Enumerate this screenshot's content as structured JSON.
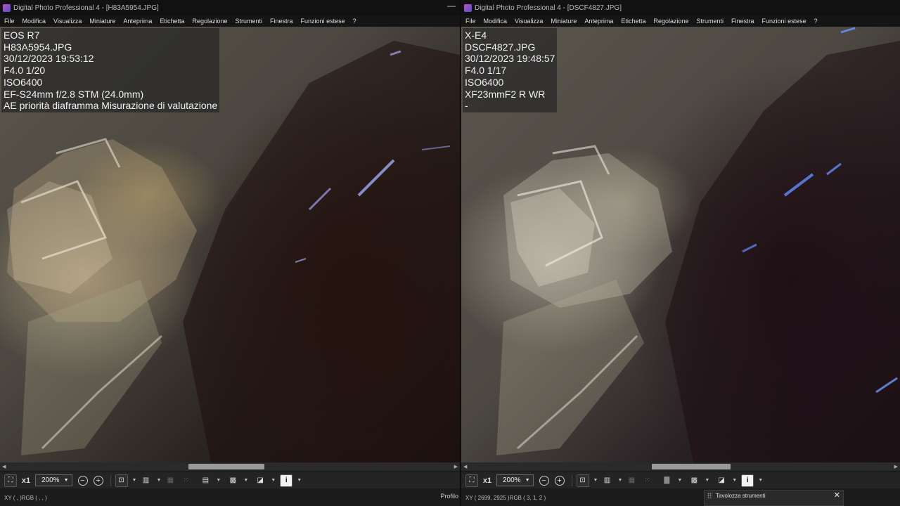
{
  "left": {
    "title": "Digital Photo Professional 4 - [H83A5954.JPG]",
    "menu": [
      "File",
      "Modifica",
      "Visualizza",
      "Miniature",
      "Anteprima",
      "Etichetta",
      "Regolazione",
      "Strumenti",
      "Finestra",
      "Funzioni estese",
      "?"
    ],
    "exif": [
      "EOS R7",
      "H83A5954.JPG",
      "30/12/2023 19:53:12",
      "F4.0 1/20",
      "ISO6400",
      "EF-S24mm f/2.8 STM (24.0mm)",
      "AE priorità diaframma Misurazione di valutazione"
    ],
    "zoom_factor": "x1",
    "zoom_value": "200%",
    "status": "XY (    ,    )RGB (   ,   ,   )",
    "profilo": "Profilo",
    "scroll_position": 0.49
  },
  "right": {
    "title": "Digital Photo Professional 4 - [DSCF4827.JPG]",
    "menu": [
      "File",
      "Modifica",
      "Visualizza",
      "Miniature",
      "Anteprima",
      "Etichetta",
      "Regolazione",
      "Strumenti",
      "Finestra",
      "Funzioni estese",
      "?"
    ],
    "exif": [
      "X-E4",
      "DSCF4827.JPG",
      "30/12/2023 19:48:57",
      "F4.0 1/17",
      "ISO6400",
      "XF23mmF2 R WR",
      "-"
    ],
    "zoom_factor": "x1",
    "zoom_value": "200%",
    "status": "XY ( 2699, 2925 )RGB (  3,   1,   2 )",
    "scroll_position": 0.53
  },
  "palette": {
    "title": "Tavolozza strumenti",
    "close": "✕"
  },
  "icons": {
    "fit": "fit-window-icon",
    "zoom_out": "zoom-out-icon",
    "zoom_in": "zoom-in-icon",
    "af_point": "af-point-icon",
    "layout": "layout-icon",
    "grid": "grid-icon",
    "highlight": "highlight-warning-icon",
    "color": "color-adjust-icon",
    "info": "info-icon"
  }
}
